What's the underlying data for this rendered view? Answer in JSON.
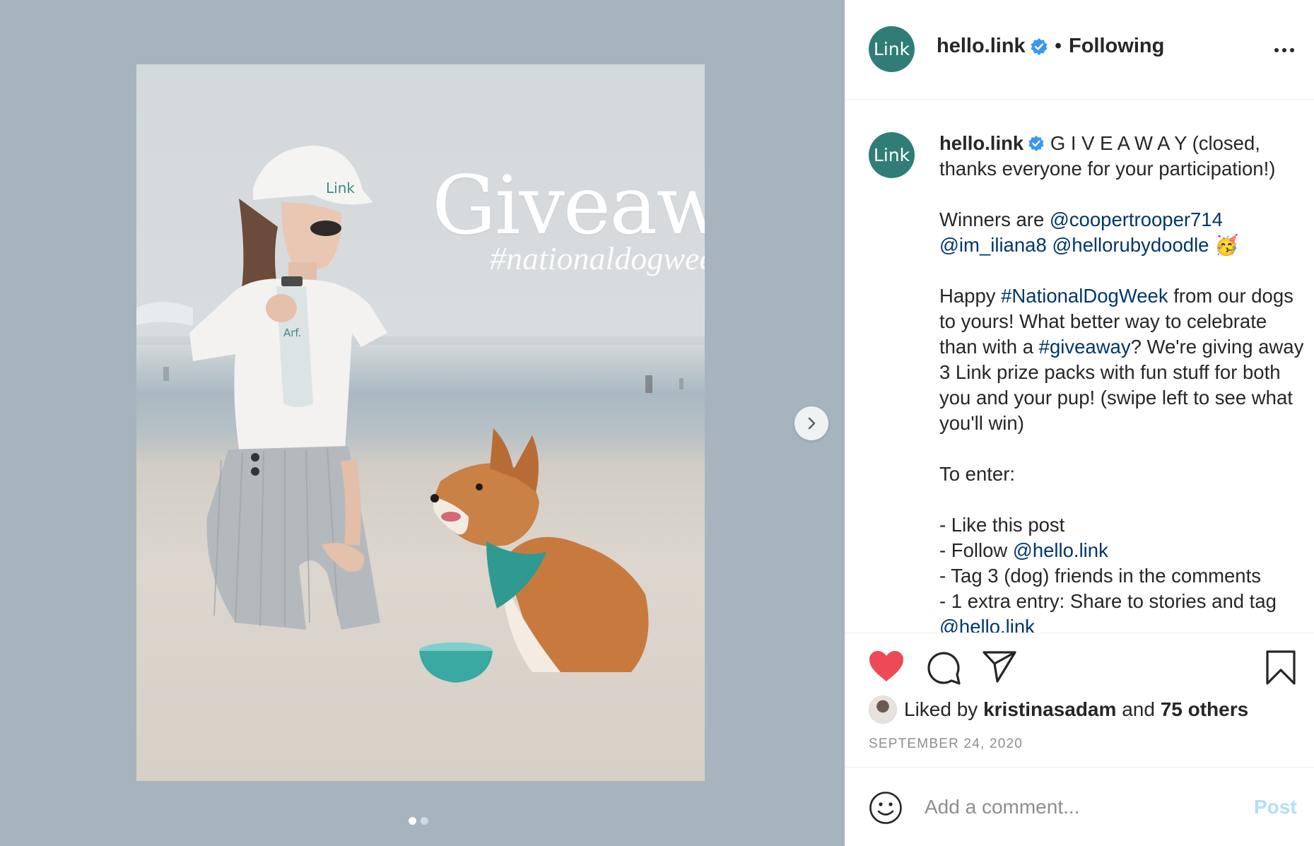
{
  "media": {
    "overlay_title": "Giveaway!",
    "overlay_hashtag": "#nationaldogweek",
    "cap_logo_text": "Link",
    "bottle_text": "Arf.",
    "carousel_total": 2,
    "carousel_active": 1
  },
  "post": {
    "header": {
      "avatar_text": "Link",
      "username": "hello.link",
      "separator": "•",
      "follow_state": "Following"
    },
    "caption": {
      "avatar_text": "Link",
      "username": "hello.link",
      "intro": " G I V E A W A Y (closed, thanks everyone for your participation!)",
      "winners_prefix": "Winners are ",
      "winner_1": "@coopertrooper714",
      "winner_2": "@im_iliana8",
      "winner_3": "@hellorubydoodle",
      "winners_emoji": "🥳",
      "happy_prefix": "Happy ",
      "hashtag_1": "#NationalDogWeek",
      "happy_mid": " from our dogs to yours! What better way to celebrate than with a ",
      "hashtag_2": "#giveaway",
      "happy_end": "? We're giving away 3 Link prize packs with fun stuff for both you and your pup! (swipe left to see what you'll win)",
      "enter_title": "To enter:",
      "rule_1": "- Like this post",
      "rule_2_prefix": "- Follow ",
      "rule_2_mention": "@hello.link",
      "rule_3": "- Tag 3 (dog) friends in the comments",
      "rule_4": "- 1 extra entry: Share to stories and tag",
      "rule_4_mention": "@hello.link"
    },
    "likes": {
      "prefix": "Liked by ",
      "user": "kristinasadam",
      "middle": " and ",
      "others": "75 others"
    },
    "date": "SEPTEMBER 24, 2020",
    "comment": {
      "placeholder": "Add a comment...",
      "post_label": "Post"
    }
  },
  "icons": {
    "like": "heart-filled-icon",
    "comment": "speech-bubble-icon",
    "share": "paper-plane-icon",
    "save": "bookmark-icon",
    "emoji": "smiley-icon",
    "next": "chevron-right-icon",
    "verified": "verified-badge-icon",
    "more": "more-horizontal-icon"
  },
  "colors": {
    "like_red": "#ed4956",
    "link_blue": "#00376b",
    "brand_teal": "#2f7d76",
    "verified_blue": "#3897f0",
    "post_disabled": "#b2dffc"
  }
}
